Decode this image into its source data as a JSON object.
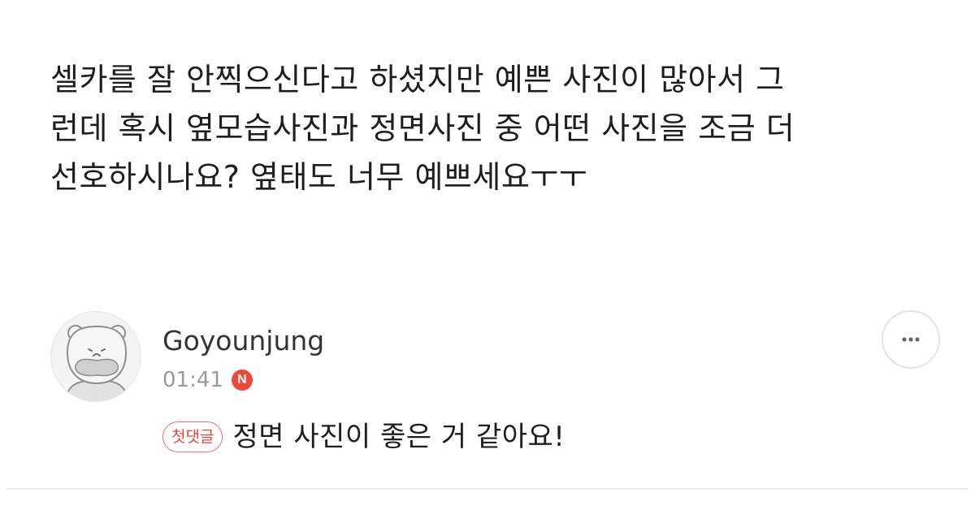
{
  "question": {
    "lines": [
      "셀카를 잘 안찍으신다고 하셨지만 예쁜 사진이 많아서 그",
      "런데 혹시 옆모습사진과 정면사진 중 어떤 사진을 조금 더",
      "선호하시나요? 옆태도 너무 예쁘세요ㅜㅜ"
    ]
  },
  "answer": {
    "author": "Goyounjung",
    "time": "01:41",
    "new_badge": "N",
    "first_comment_badge": "첫댓글",
    "text": "정면 사진이 좋은 거 같아요!",
    "avatar_icon": "bear-avatar-icon",
    "more_icon": "ellipsis-icon"
  },
  "colors": {
    "accent": "#f0473a",
    "badge_border": "#f26a6a",
    "muted_text": "#9a9a9a",
    "divider": "#ececec"
  }
}
